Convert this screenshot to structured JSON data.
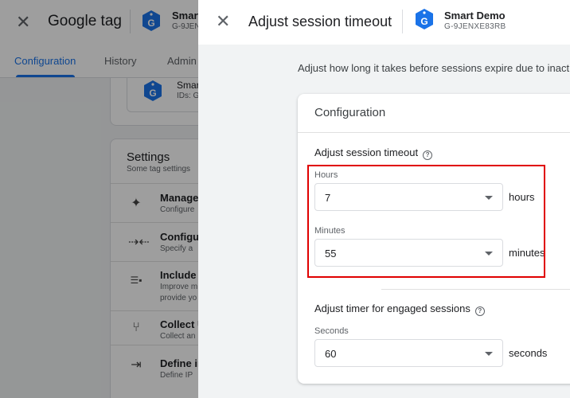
{
  "background": {
    "app_title": "Google tag",
    "account": {
      "name": "Smart",
      "id": "G-9JEN"
    },
    "tabs": [
      {
        "label": "Configuration",
        "active": true
      },
      {
        "label": "History",
        "active": false
      },
      {
        "label": "Admin",
        "active": false
      }
    ],
    "tag_card": {
      "name": "Smar",
      "ids": "IDs: G"
    },
    "settings": {
      "title": "Settings",
      "subtitle": "Some tag settings",
      "items": [
        {
          "icon": "sparkle-icon",
          "title": "Manage",
          "desc1": "Configure",
          "desc2": ""
        },
        {
          "icon": "collapse-arrows-icon",
          "title": "Configu",
          "desc1": "Specify a",
          "desc2": ""
        },
        {
          "icon": "list-badge-icon",
          "title": "Include u",
          "desc1": "Improve m",
          "desc2": "provide yo"
        },
        {
          "icon": "merge-icon",
          "title": "Collect U",
          "desc1": "Collect an",
          "desc2": ""
        },
        {
          "icon": "input-icon",
          "title": "Define in",
          "desc1": "Define IP",
          "desc2": ""
        }
      ]
    }
  },
  "panel": {
    "title": "Adjust session timeout",
    "account": {
      "name": "Smart Demo",
      "id": "G-9JENXE83RB"
    },
    "intro": "Adjust how long it takes before sessions expire due to inactiv",
    "card_title": "Configuration",
    "session_timeout": {
      "title": "Adjust session timeout",
      "hours": {
        "label": "Hours",
        "value": "7",
        "unit": "hours"
      },
      "minutes": {
        "label": "Minutes",
        "value": "55",
        "unit": "minutes"
      }
    },
    "engaged": {
      "title": "Adjust timer for engaged sessions",
      "seconds": {
        "label": "Seconds",
        "value": "60",
        "unit": "seconds"
      }
    }
  },
  "colors": {
    "accent": "#1a73e8",
    "highlight": "#e00000",
    "tag_logo": "#1a73e8"
  }
}
